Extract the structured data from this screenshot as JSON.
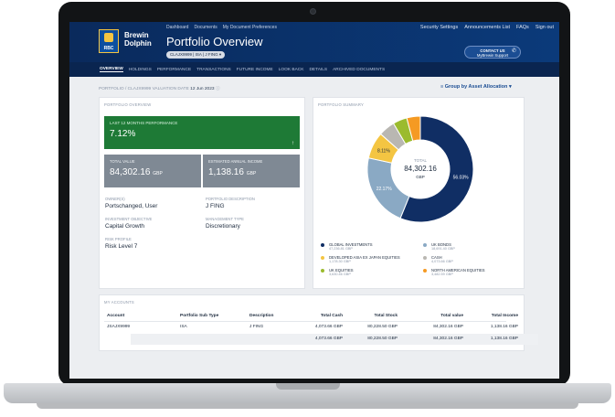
{
  "header": {
    "brand_line1": "Brewin",
    "brand_line2": "Dolphin",
    "logo_text": "RBC",
    "top_links": [
      "Dashboard",
      "Documents",
      "My Document Preferences"
    ],
    "title": "Portfolio Overview",
    "account_pill": "CLAJX9999 | ISA | J FING",
    "right_links": [
      "Security Settings",
      "Announcements List",
      "FAQs",
      "Sign out"
    ],
    "contact_line1": "CONTACT US",
    "contact_line2": "MyBrewin Support"
  },
  "nav": {
    "items": [
      "OVERVIEW",
      "HOLDINGS",
      "PERFORMANCE",
      "TRANSACTIONS",
      "FUTURE INCOME",
      "LOOK BACK",
      "DETAILS",
      "ARCHIVED DOCUMENTS"
    ],
    "active": "OVERVIEW"
  },
  "breadcrumb": {
    "text": "PORTFOLIO / CLAJX9999 VALUATION DATE",
    "date": "12 Jun 2023"
  },
  "group_by": "Group by Asset Allocation",
  "overview": {
    "label": "PORTFOLIO OVERVIEW",
    "perf_label": "LAST 12 MONTHS PERFORMANCE",
    "perf_value": "7.12%",
    "total_label": "TOTAL VALUE",
    "total_value": "84,302.16",
    "total_cur": "GBP",
    "income_label": "ESTIMATED ANNUAL INCOME",
    "income_value": "1,138.16",
    "income_cur": "GBP",
    "owners_label": "OWNER(S)",
    "owners_value": "Portschanged, User",
    "desc_label": "PORTFOLIO DESCRIPTION",
    "desc_value": "J FING",
    "objective_label": "INVESTMENT OBJECTIVE",
    "objective_value": "Capital Growth",
    "mgmt_label": "MANAGEMENT TYPE",
    "mgmt_value": "Discretionary",
    "risk_label": "RISK PROFILE",
    "risk_value": "Risk Level 7"
  },
  "summary": {
    "label": "PORTFOLIO SUMMARY",
    "center_label": "TOTAL",
    "center_value": "84,302",
    "center_decimals": ".16",
    "center_cur": "GBP",
    "slice_labels": [
      "56.03%",
      "22.17%",
      "8.11%"
    ],
    "colors": {
      "global": "#102e64",
      "ukbonds": "#8aa9c4",
      "japan": "#f4c542",
      "cash": "#b9b7b2",
      "ukeq": "#9bbb2e",
      "na": "#f59a23"
    },
    "legend": [
      {
        "name": "GLOBAL INVESTMENTS",
        "amount": "47,236.81 GBP"
      },
      {
        "name": "UK BONDS",
        "amount": "18,691.40 GBP"
      },
      {
        "name": "DEVELOPED ASIA EX JAPAN EQUITIES",
        "amount": "1,178.30 GBP"
      },
      {
        "name": "CASH",
        "amount": "4,073.66 GBP"
      },
      {
        "name": "UK EQUITIES",
        "amount": "3,630.46 GBP"
      },
      {
        "name": "NORTH AMERICAN EQUITIES",
        "amount": "3,482.59 GBP"
      }
    ]
  },
  "chart_data": {
    "type": "pie",
    "categories": [
      "GLOBAL INVESTMENTS",
      "UK BONDS",
      "DEVELOPED ASIA EX JAPAN EQUITIES",
      "CASH",
      "UK EQUITIES",
      "NORTH AMERICAN EQUITIES"
    ],
    "values": [
      56.03,
      22.17,
      8.11,
      5.0,
      4.3,
      4.13
    ]
  },
  "accounts": {
    "label": "MY ACCOUNTS",
    "headers": [
      "Account",
      "Portfolio Sub Type",
      "Description",
      "Total Cash",
      "Total Stock",
      "Total value",
      "Total Income"
    ],
    "row": [
      "JSAJX9999",
      "ISA",
      "J FING",
      "4,073.66 GBP",
      "80,228.50 GBP",
      "84,302.16 GBP",
      "1,138.16 GBP"
    ],
    "totals": [
      "4,073.66 GBP",
      "80,228.50 GBP",
      "84,302.16 GBP",
      "1,138.16 GBP"
    ]
  }
}
